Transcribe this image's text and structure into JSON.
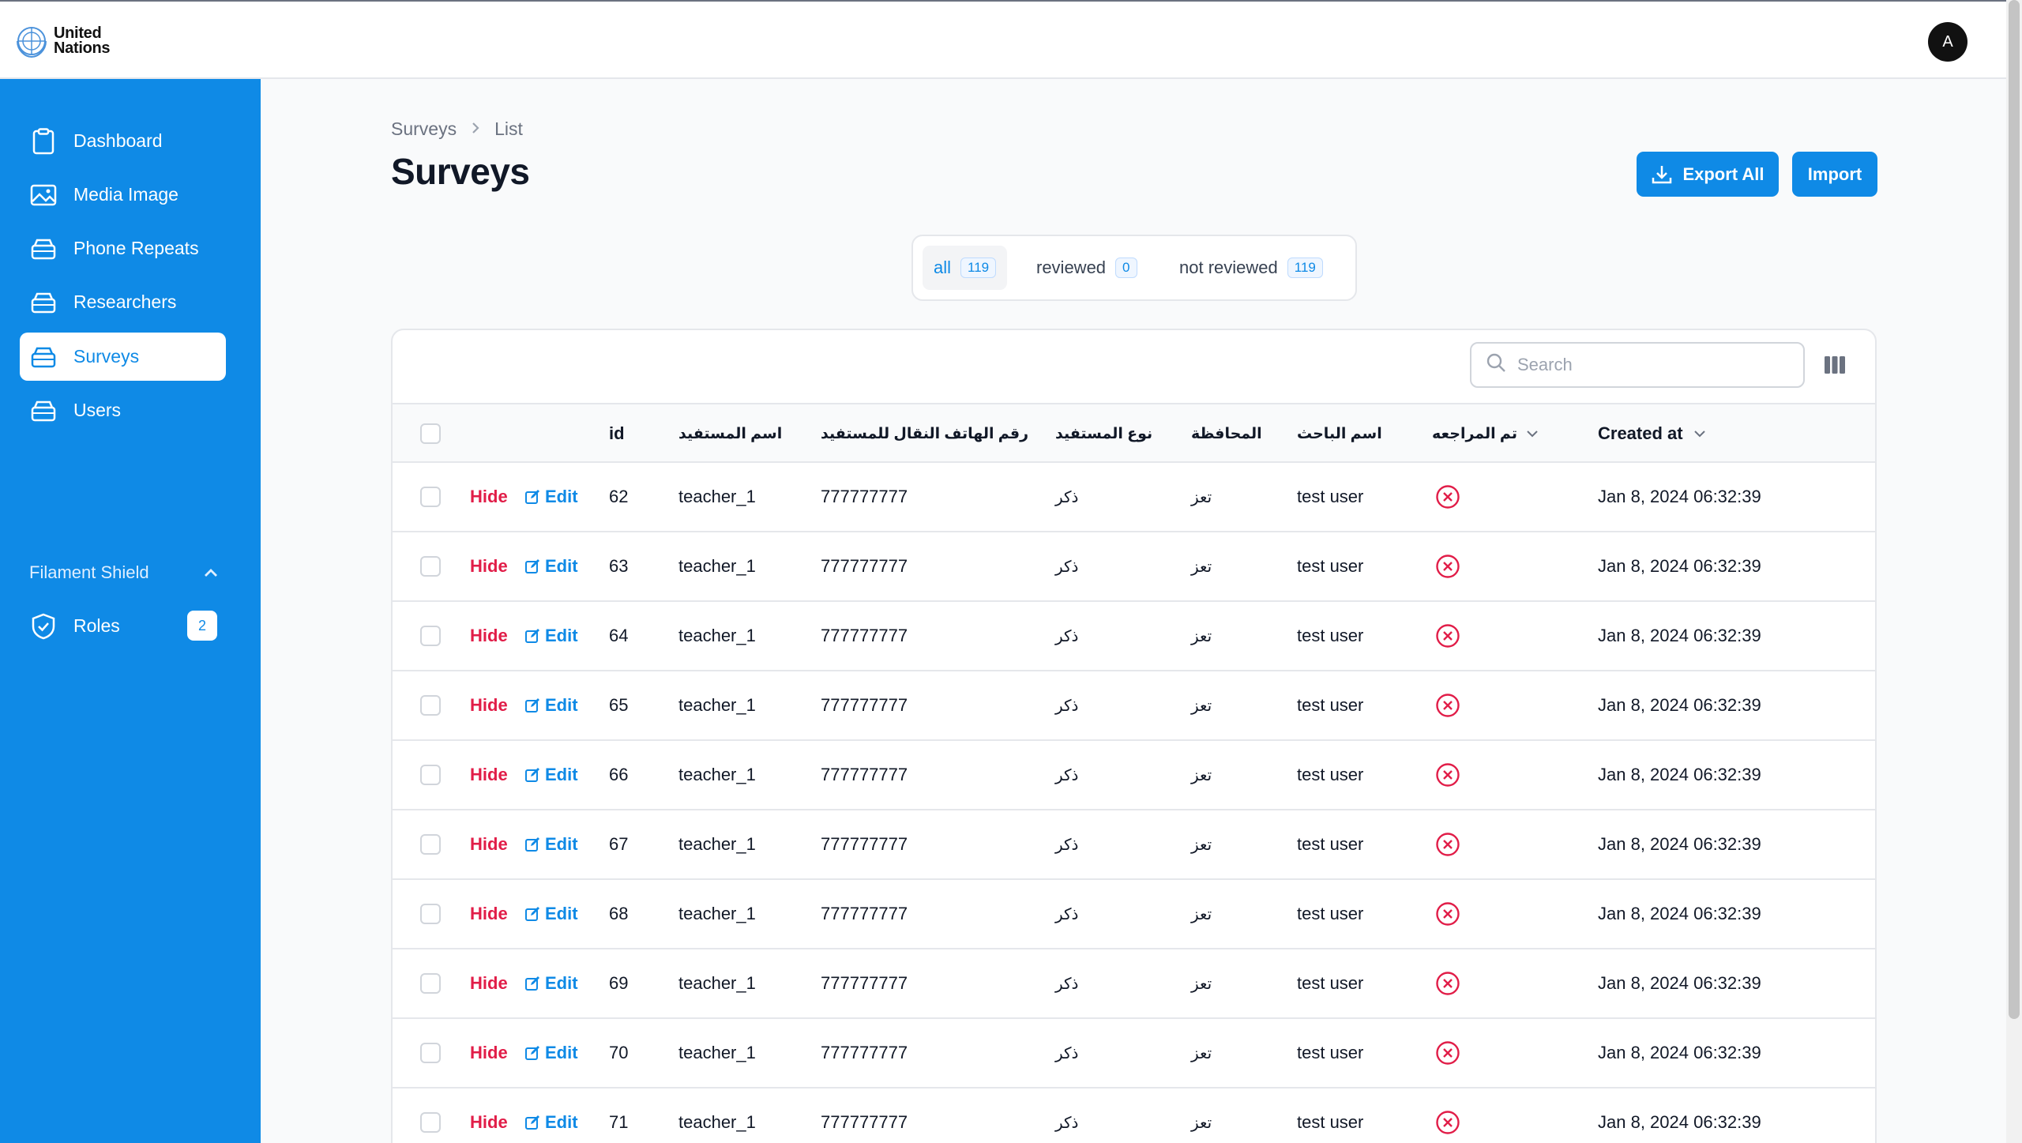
{
  "brand": {
    "logo_line1": "United",
    "logo_line2": "Nations"
  },
  "user": {
    "avatar_initial": "A"
  },
  "sidebar": {
    "items": [
      {
        "label": "Dashboard",
        "icon": "clipboard-icon"
      },
      {
        "label": "Media Image",
        "icon": "image-icon"
      },
      {
        "label": "Phone Repeats",
        "icon": "box-icon"
      },
      {
        "label": "Researchers",
        "icon": "box-icon"
      },
      {
        "label": "Surveys",
        "icon": "box-icon",
        "active": true
      },
      {
        "label": "Users",
        "icon": "box-icon"
      }
    ],
    "group": {
      "label": "Filament Shield",
      "items": [
        {
          "label": "Roles",
          "badge": "2",
          "icon": "shield-check-icon"
        }
      ]
    }
  },
  "breadcrumb": {
    "parent": "Surveys",
    "current": "List"
  },
  "page": {
    "title": "Surveys"
  },
  "actions": {
    "export_label": "Export All",
    "import_label": "Import"
  },
  "tabs": [
    {
      "label": "all",
      "count": "119",
      "active": true
    },
    {
      "label": "reviewed",
      "count": "0"
    },
    {
      "label": "not reviewed",
      "count": "119"
    }
  ],
  "search": {
    "placeholder": "Search"
  },
  "table": {
    "columns": {
      "id": "id",
      "beneficiary_name": "اسم المستفيد",
      "beneficiary_phone": "رقم الهاتف النقال للمستفيد",
      "beneficiary_type": "نوع المستفيد",
      "governorate": "المحافظة",
      "researcher": "اسم الباحث",
      "reviewed": "تم المراجعه",
      "created_at": "Created at"
    },
    "row_actions": {
      "hide": "Hide",
      "edit": "Edit"
    },
    "rows": [
      {
        "id": "62",
        "name": "teacher_1",
        "phone": "777777777",
        "type": "ذكر",
        "gov": "تعز",
        "researcher": "test user",
        "reviewed": false,
        "created": "Jan 8, 2024 06:32:39"
      },
      {
        "id": "63",
        "name": "teacher_1",
        "phone": "777777777",
        "type": "ذكر",
        "gov": "تعز",
        "researcher": "test user",
        "reviewed": false,
        "created": "Jan 8, 2024 06:32:39"
      },
      {
        "id": "64",
        "name": "teacher_1",
        "phone": "777777777",
        "type": "ذكر",
        "gov": "تعز",
        "researcher": "test user",
        "reviewed": false,
        "created": "Jan 8, 2024 06:32:39"
      },
      {
        "id": "65",
        "name": "teacher_1",
        "phone": "777777777",
        "type": "ذكر",
        "gov": "تعز",
        "researcher": "test user",
        "reviewed": false,
        "created": "Jan 8, 2024 06:32:39"
      },
      {
        "id": "66",
        "name": "teacher_1",
        "phone": "777777777",
        "type": "ذكر",
        "gov": "تعز",
        "researcher": "test user",
        "reviewed": false,
        "created": "Jan 8, 2024 06:32:39"
      },
      {
        "id": "67",
        "name": "teacher_1",
        "phone": "777777777",
        "type": "ذكر",
        "gov": "تعز",
        "researcher": "test user",
        "reviewed": false,
        "created": "Jan 8, 2024 06:32:39"
      },
      {
        "id": "68",
        "name": "teacher_1",
        "phone": "777777777",
        "type": "ذكر",
        "gov": "تعز",
        "researcher": "test user",
        "reviewed": false,
        "created": "Jan 8, 2024 06:32:39"
      },
      {
        "id": "69",
        "name": "teacher_1",
        "phone": "777777777",
        "type": "ذكر",
        "gov": "تعز",
        "researcher": "test user",
        "reviewed": false,
        "created": "Jan 8, 2024 06:32:39"
      },
      {
        "id": "70",
        "name": "teacher_1",
        "phone": "777777777",
        "type": "ذكر",
        "gov": "تعز",
        "researcher": "test user",
        "reviewed": false,
        "created": "Jan 8, 2024 06:32:39"
      },
      {
        "id": "71",
        "name": "teacher_1",
        "phone": "777777777",
        "type": "ذكر",
        "gov": "تعز",
        "researcher": "test user",
        "reviewed": false,
        "created": "Jan 8, 2024 06:32:39"
      }
    ]
  },
  "colors": {
    "primary": "#0f8ae6",
    "danger": "#e11d48",
    "sidebar_bg": "#0f8ae6"
  }
}
